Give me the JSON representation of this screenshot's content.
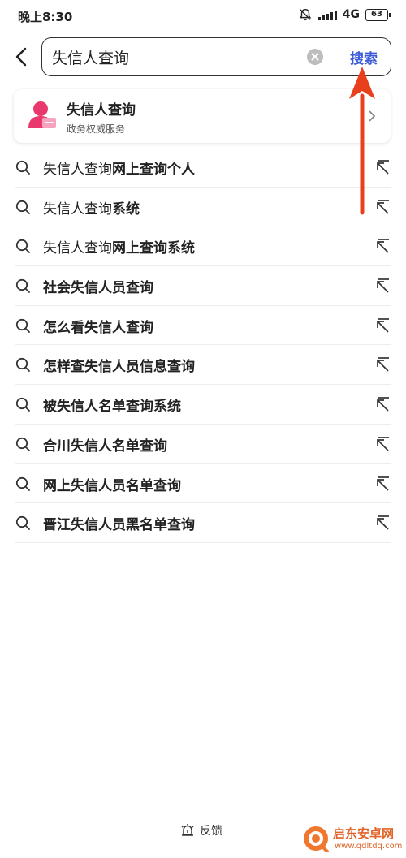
{
  "status_bar": {
    "time": "晚上8:30",
    "network": "4G",
    "battery": "63"
  },
  "search": {
    "query": "失信人查询",
    "button_label": "搜索",
    "accent_color": "#3b5bd6"
  },
  "service_card": {
    "title": "失信人查询",
    "subtitle": "政务权威服务",
    "icon_color": "#e8386d"
  },
  "suggestions": [
    {
      "prefix": "失信人查询",
      "suffix": "网上查询个人"
    },
    {
      "prefix": "失信人查询",
      "suffix": "系统"
    },
    {
      "prefix": "失信人查询",
      "suffix": "网上查询系统"
    },
    {
      "prefix": "",
      "suffix": "社会失信人员查询"
    },
    {
      "prefix": "",
      "suffix": "怎么看失信人查询"
    },
    {
      "prefix": "",
      "suffix": "怎样查失信人员信息查询"
    },
    {
      "prefix": "",
      "suffix": "被失信人名单查询系统"
    },
    {
      "prefix": "",
      "suffix": "合川失信人名单查询"
    },
    {
      "prefix": "",
      "suffix": "网上失信人员名单查询"
    },
    {
      "prefix": "",
      "suffix": "晋江失信人员黑名单查询"
    }
  ],
  "icons": {
    "back": "back-chevron-icon",
    "clear": "clear-icon",
    "suggestion": "search-icon",
    "fill": "arrow-up-left-icon",
    "feedback": "feedback-icon"
  },
  "footer": {
    "feedback_label": "反馈"
  },
  "watermark": {
    "name": "启东安卓网",
    "url": "www.qdltdq.com"
  },
  "annotation_color": "#e8401c"
}
